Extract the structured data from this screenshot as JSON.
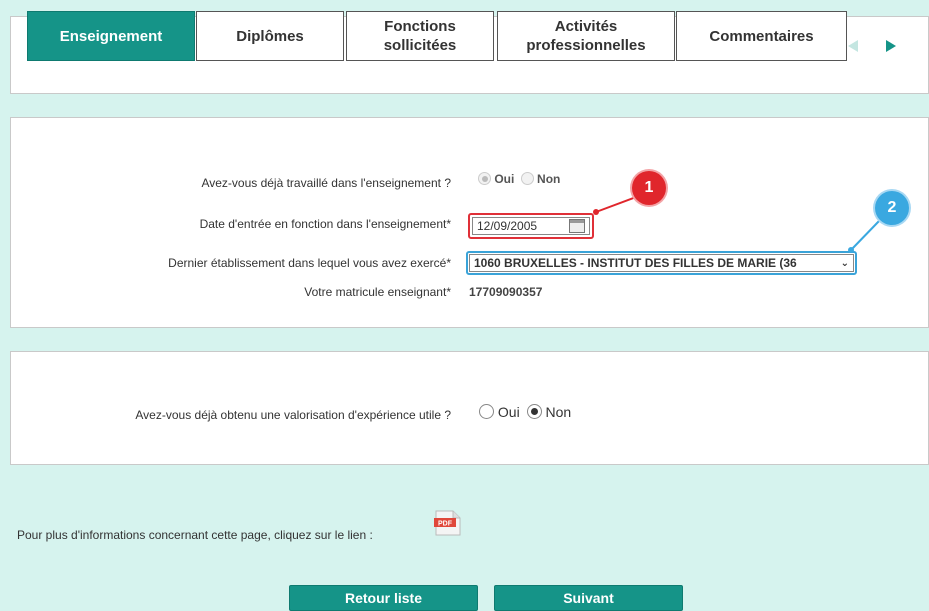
{
  "tabs": [
    {
      "label": "Enseignement",
      "active": true
    },
    {
      "label": "Diplômes"
    },
    {
      "label": "Fonctions sollicitées"
    },
    {
      "label": "Activités professionnelles"
    },
    {
      "label": "Commentaires"
    }
  ],
  "section1": {
    "q_worked": "Avez-vous déjà travaillé dans l'enseignement ?",
    "opt_yes": "Oui",
    "opt_no": "Non",
    "q_date": "Date d'entrée en fonction dans l'enseignement*",
    "date_value": "12/09/2005",
    "q_last_school": "Dernier établissement dans lequel vous avez exercé*",
    "last_school_value": "1060 BRUXELLES - INSTITUT DES FILLES DE MARIE (36",
    "q_matricule": "Votre matricule enseignant*",
    "matricule_value": "17709090357"
  },
  "section2": {
    "q_valorisation": "Avez-vous déjà obtenu une valorisation d'expérience utile ?",
    "opt_yes": "Oui",
    "opt_no": "Non"
  },
  "info": {
    "text": "Pour plus d'informations concernant cette page, cliquez sur le lien :",
    "pdf_label": "PDF"
  },
  "annotations": {
    "badge1": "1",
    "badge2": "2"
  },
  "buttons": {
    "back": "Retour liste",
    "next": "Suivant"
  },
  "colors": {
    "accent": "#159488",
    "background": "#d6f3ee",
    "callout_red": "#e0262c",
    "callout_blue": "#3aa8e0"
  }
}
